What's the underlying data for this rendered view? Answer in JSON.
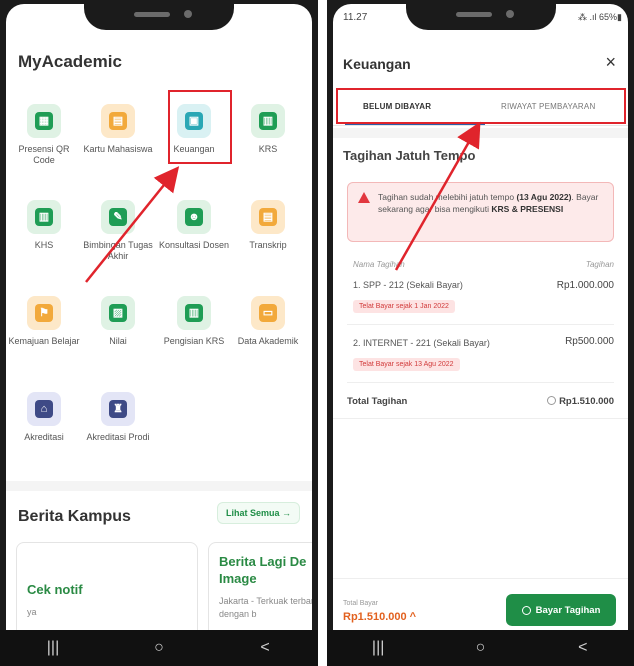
{
  "left": {
    "app_title": "MyAcademic",
    "menu": [
      {
        "label": "Presensi QR Code",
        "icon": "qr-code-icon",
        "glyph": "▦"
      },
      {
        "label": "Kartu Mahasiswa",
        "icon": "student-card-icon",
        "glyph": "▤"
      },
      {
        "label": "Keuangan",
        "icon": "finance-icon",
        "glyph": "▣"
      },
      {
        "label": "KRS",
        "icon": "krs-icon",
        "glyph": "▥"
      },
      {
        "label": "KHS",
        "icon": "khs-icon",
        "glyph": "▥"
      },
      {
        "label": "Bimbingan Tugas Akhir",
        "icon": "thesis-guidance-icon",
        "glyph": "✎"
      },
      {
        "label": "Konsultasi Dosen",
        "icon": "lecturer-consultation-icon",
        "glyph": "☻"
      },
      {
        "label": "Transkrip",
        "icon": "transcript-icon",
        "glyph": "▤"
      },
      {
        "label": "Kemajuan Belajar",
        "icon": "learning-progress-icon",
        "glyph": "⚑"
      },
      {
        "label": "Nilai",
        "icon": "grades-icon",
        "glyph": "▨"
      },
      {
        "label": "Pengisian KRS",
        "icon": "krs-filling-icon",
        "glyph": "▥"
      },
      {
        "label": "Data Akademik",
        "icon": "academic-data-icon",
        "glyph": "▭"
      },
      {
        "label": "Akreditasi",
        "icon": "accreditation-icon",
        "glyph": "⌂"
      },
      {
        "label": "Akreditasi Prodi",
        "icon": "program-accreditation-icon",
        "glyph": "♜"
      }
    ],
    "news_title": "Berita Kampus",
    "see_all": "Lihat Semua →",
    "cards": [
      {
        "title": "Cek notif",
        "desc": "ya"
      },
      {
        "title": "Berita Lagi De Image",
        "desc": "Jakarta - Terkuak terbaru dengan b"
      }
    ],
    "nav": [
      "|||",
      "○",
      "<"
    ]
  },
  "right": {
    "time": "11.27",
    "status": "⁂ .ıl 65%▮",
    "title": "Keuangan",
    "close": "×",
    "tab_unpaid": "BELUM DIBAYAR",
    "tab_history": "RIWAYAT PEMBAYARAN",
    "section_title": "Tagihan Jatuh Tempo",
    "alert_pre": "Tagihan sudah melebihi jatuh tempo ",
    "alert_date": "(13 Agu 2022)",
    "alert_mid": ". Bayar sekarang agar bisa mengikuti ",
    "alert_bold": "KRS & PRESENSI",
    "col_name": "Nama Tagihan",
    "col_amount": "Tagihan",
    "bills": [
      {
        "name": "1. SPP - 212 (Sekali Bayar)",
        "amount": "Rp1.000.000",
        "late": "Telat Bayar sejak 1 Jan 2022"
      },
      {
        "name": "2. INTERNET - 221 (Sekali Bayar)",
        "amount": "Rp500.000",
        "late": "Telat Bayar sejak 13 Agu 2022"
      }
    ],
    "total_label": "Total Tagihan",
    "total_amount": "Rp1.510.000",
    "footer_label": "Total Bayar",
    "footer_amount": "Rp1.510.000 ^",
    "pay_button": "Bayar Tagihan",
    "nav": [
      "|||",
      "○",
      "<"
    ]
  },
  "colors": {
    "brand_green": "#1f8e47",
    "alert_red": "#e0242c",
    "amount_orange": "#e2611f"
  }
}
